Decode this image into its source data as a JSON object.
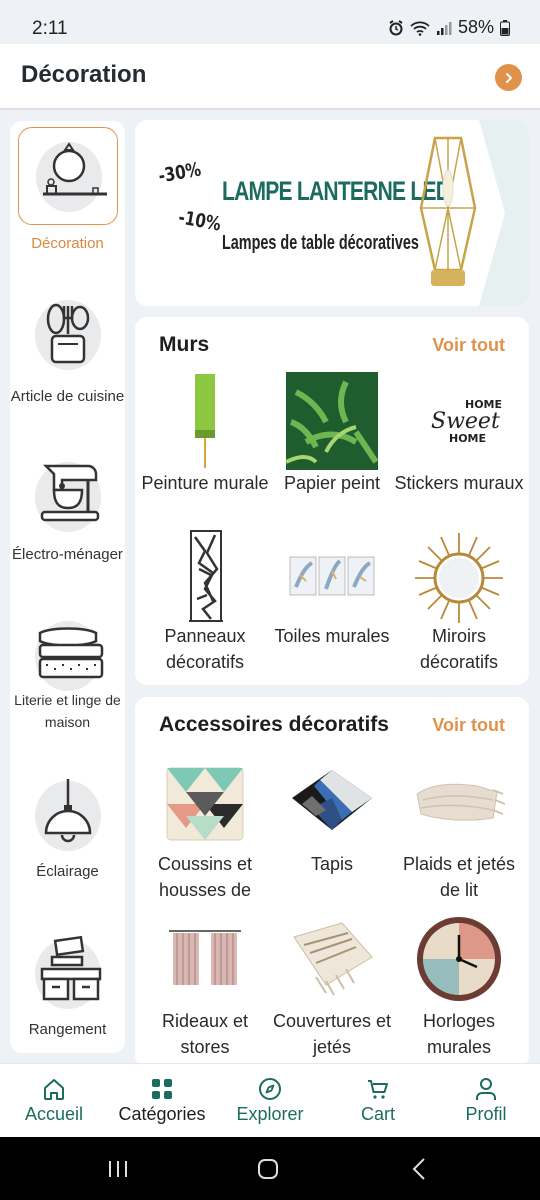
{
  "status": {
    "time": "2:11",
    "battery": "58%"
  },
  "header": {
    "title": "Décoration"
  },
  "sidebar": {
    "items": [
      {
        "label": "Décoration",
        "icon": "mirror-icon",
        "active": true
      },
      {
        "label": "Article de cuisine",
        "icon": "utensils-icon",
        "active": false
      },
      {
        "label": "Électro-ménager",
        "icon": "stand-mixer-icon",
        "active": false
      },
      {
        "label": "Literie et linge de maison",
        "icon": "bedding-icon",
        "active": false
      },
      {
        "label": "Éclairage",
        "icon": "pendant-lamp-icon",
        "active": false
      },
      {
        "label": "Rangement",
        "icon": "storage-boxes-icon",
        "active": false
      }
    ]
  },
  "banner": {
    "discount_1": "-30%",
    "discount_2": "-10%",
    "title": "LAMPE LANTERNE LED",
    "subtitle": "Lampes de table décoratives"
  },
  "sections": [
    {
      "title": "Murs",
      "see_all": "Voir tout",
      "items": [
        {
          "label": "Peinture murale"
        },
        {
          "label": "Papier peint"
        },
        {
          "label": "Stickers muraux",
          "sticker_text_1": "HOME",
          "sticker_text_2": "Sweet",
          "sticker_text_3": "HOME"
        },
        {
          "label": "Panneaux décoratifs"
        },
        {
          "label": "Toiles murales"
        },
        {
          "label": "Miroirs décoratifs"
        }
      ]
    },
    {
      "title": "Accessoires décoratifs",
      "see_all": "Voir tout",
      "items": [
        {
          "label": "Coussins et housses de"
        },
        {
          "label": "Tapis"
        },
        {
          "label": "Plaids et jetés de lit"
        },
        {
          "label": "Rideaux et stores"
        },
        {
          "label": "Couvertures et jetés"
        },
        {
          "label": "Horloges murales"
        }
      ]
    }
  ],
  "bottom_nav": [
    {
      "label": "Accueil",
      "icon": "home-icon",
      "active": false
    },
    {
      "label": "Catégories",
      "icon": "grid-icon",
      "active": true
    },
    {
      "label": "Explorer",
      "icon": "compass-icon",
      "active": false
    },
    {
      "label": "Cart",
      "icon": "cart-icon",
      "active": false
    },
    {
      "label": "Profil",
      "icon": "user-icon",
      "active": false
    }
  ],
  "colors": {
    "accent": "#e0924b",
    "brand_green": "#1c6c5d",
    "background": "#eef1f5"
  }
}
